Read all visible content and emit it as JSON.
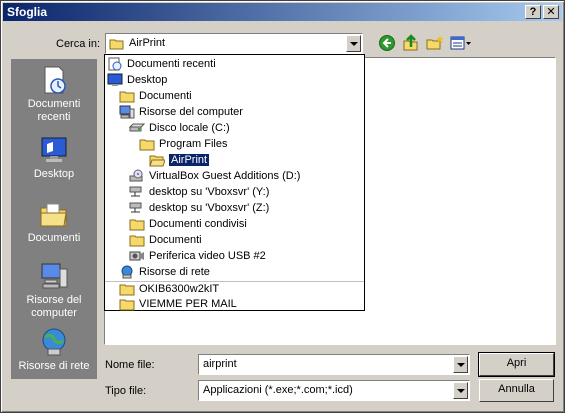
{
  "window": {
    "title": "Sfoglia",
    "help_btn": "?",
    "close_btn": "✕"
  },
  "lookin": {
    "label": "Cerca in:",
    "value": "AirPrint"
  },
  "toolbar": {
    "icons": [
      "back-icon",
      "up-folder-icon",
      "new-folder-icon",
      "view-menu-icon"
    ]
  },
  "places": [
    {
      "label": "Documenti recenti",
      "icon": "recent-documents-icon"
    },
    {
      "label": "Desktop",
      "icon": "desktop-icon"
    },
    {
      "label": "Documenti",
      "icon": "documents-folder-icon"
    },
    {
      "label": "Risorse del computer",
      "icon": "my-computer-icon"
    },
    {
      "label": "Risorse di rete",
      "icon": "network-icon"
    }
  ],
  "dropdown_items": [
    {
      "label": "Documenti recenti",
      "icon": "recent-documents-icon"
    },
    {
      "label": "Desktop",
      "icon": "desktop-icon"
    },
    {
      "label": "Documenti",
      "icon": "folder-icon"
    },
    {
      "label": "Risorse del computer",
      "icon": "my-computer-icon"
    },
    {
      "label": "Disco locale (C:)",
      "icon": "drive-icon"
    },
    {
      "label": "Program Files",
      "icon": "folder-icon"
    },
    {
      "label": "AirPrint",
      "icon": "folder-open-icon",
      "selected": true
    },
    {
      "label": "VirtualBox Guest Additions (D:)",
      "icon": "cd-drive-icon"
    },
    {
      "label": "desktop su 'Vboxsvr' (Y:)",
      "icon": "network-drive-icon"
    },
    {
      "label": "desktop su 'Vboxsvr' (Z:)",
      "icon": "network-drive-icon"
    },
    {
      "label": "Documenti condivisi",
      "icon": "folder-icon"
    },
    {
      "label": "Documenti",
      "icon": "folder-icon"
    },
    {
      "label": "Periferica video USB #2",
      "icon": "usb-video-icon"
    },
    {
      "label": "Risorse di rete",
      "icon": "network-icon"
    },
    {
      "label": "OKIB6300w2kIT",
      "icon": "folder-icon"
    },
    {
      "label": "VIEMME PER MAIL",
      "icon": "folder-icon"
    }
  ],
  "filename": {
    "label": "Nome file:",
    "value": "airprint"
  },
  "filetype": {
    "label": "Tipo file:",
    "value": "Applicazioni (*.exe;*.com;*.icd)"
  },
  "buttons": {
    "open": "Apri",
    "cancel": "Annulla"
  },
  "colors": {
    "title_start": "#0a246a",
    "title_end": "#a6caf0",
    "face": "#d4d0c8",
    "places_bg": "#808080",
    "selection": "#0a246a"
  }
}
